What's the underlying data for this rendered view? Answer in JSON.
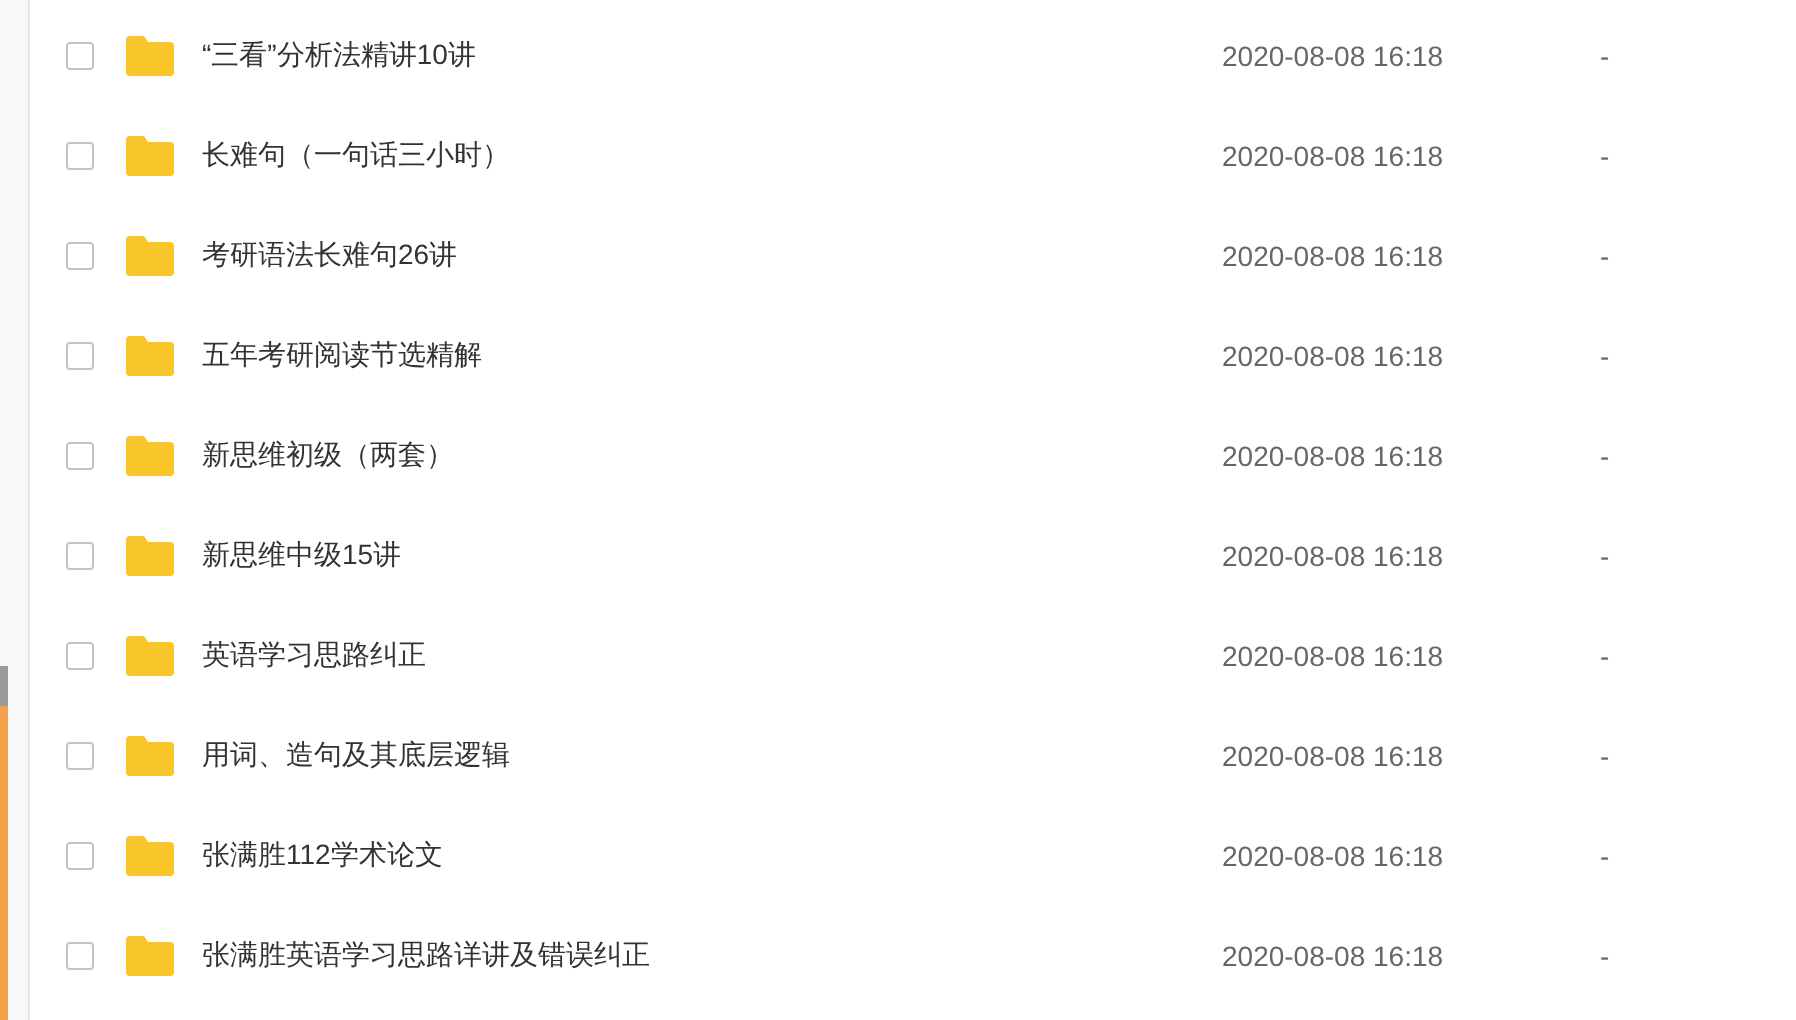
{
  "files": [
    {
      "name": "“三看”分析法精讲10讲",
      "modified": "2020-08-08 16:18",
      "size": "-",
      "checked": false
    },
    {
      "name": "长难句（一句话三小时）",
      "modified": "2020-08-08 16:18",
      "size": "-",
      "checked": false
    },
    {
      "name": "考研语法长难句26讲",
      "modified": "2020-08-08 16:18",
      "size": "-",
      "checked": false
    },
    {
      "name": "五年考研阅读节选精解",
      "modified": "2020-08-08 16:18",
      "size": "-",
      "checked": false
    },
    {
      "name": "新思维初级（两套）",
      "modified": "2020-08-08 16:18",
      "size": "-",
      "checked": false
    },
    {
      "name": "新思维中级15讲",
      "modified": "2020-08-08 16:18",
      "size": "-",
      "checked": false
    },
    {
      "name": "英语学习思路纠正",
      "modified": "2020-08-08 16:18",
      "size": "-",
      "checked": false
    },
    {
      "name": "用词、造句及其底层逻辑",
      "modified": "2020-08-08 16:18",
      "size": "-",
      "checked": false
    },
    {
      "name": "张满胜112学术论文",
      "modified": "2020-08-08 16:18",
      "size": "-",
      "checked": false
    },
    {
      "name": "张满胜英语学习思路详讲及错误纠正",
      "modified": "2020-08-08 16:18",
      "size": "-",
      "checked": false
    }
  ]
}
